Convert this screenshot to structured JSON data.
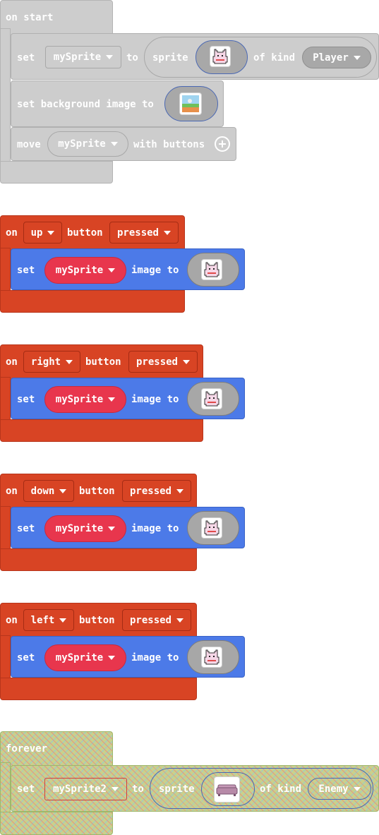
{
  "on_start": {
    "hat": "on start",
    "row1": {
      "set": "set",
      "variable": "mySprite",
      "to": "to",
      "sprite": "sprite",
      "of_kind": "of kind",
      "kind": "Player"
    },
    "row2": {
      "label": "set background image to"
    },
    "row3": {
      "move": "move",
      "variable": "mySprite",
      "with_buttons": "with buttons"
    }
  },
  "button_events": [
    {
      "on": "on",
      "button": "up",
      "button_label": "button",
      "event": "pressed",
      "set": "set",
      "variable": "mySprite",
      "image_to": "image to"
    },
    {
      "on": "on",
      "button": "right",
      "button_label": "button",
      "event": "pressed",
      "set": "set",
      "variable": "mySprite",
      "image_to": "image to"
    },
    {
      "on": "on",
      "button": "down",
      "button_label": "button",
      "event": "pressed",
      "set": "set",
      "variable": "mySprite",
      "image_to": "image to"
    },
    {
      "on": "on",
      "button": "left",
      "button_label": "button",
      "event": "pressed",
      "set": "set",
      "variable": "mySprite",
      "image_to": "image to"
    }
  ],
  "forever": {
    "hat": "forever",
    "row": {
      "set": "set",
      "variable": "mySprite2",
      "to": "to",
      "sprite": "sprite",
      "of_kind": "of kind",
      "kind": "Enemy"
    }
  },
  "colors": {
    "event_red": "#d84424",
    "sprites_blue": "#4c7ae8",
    "variable_pink": "#e8364d",
    "disabled_grey": "#cdcdcd"
  },
  "icons": [
    "cat-sprite-icon",
    "background-image-icon",
    "add-icon",
    "dropdown-arrow-icon",
    "couch-sprite-icon"
  ]
}
